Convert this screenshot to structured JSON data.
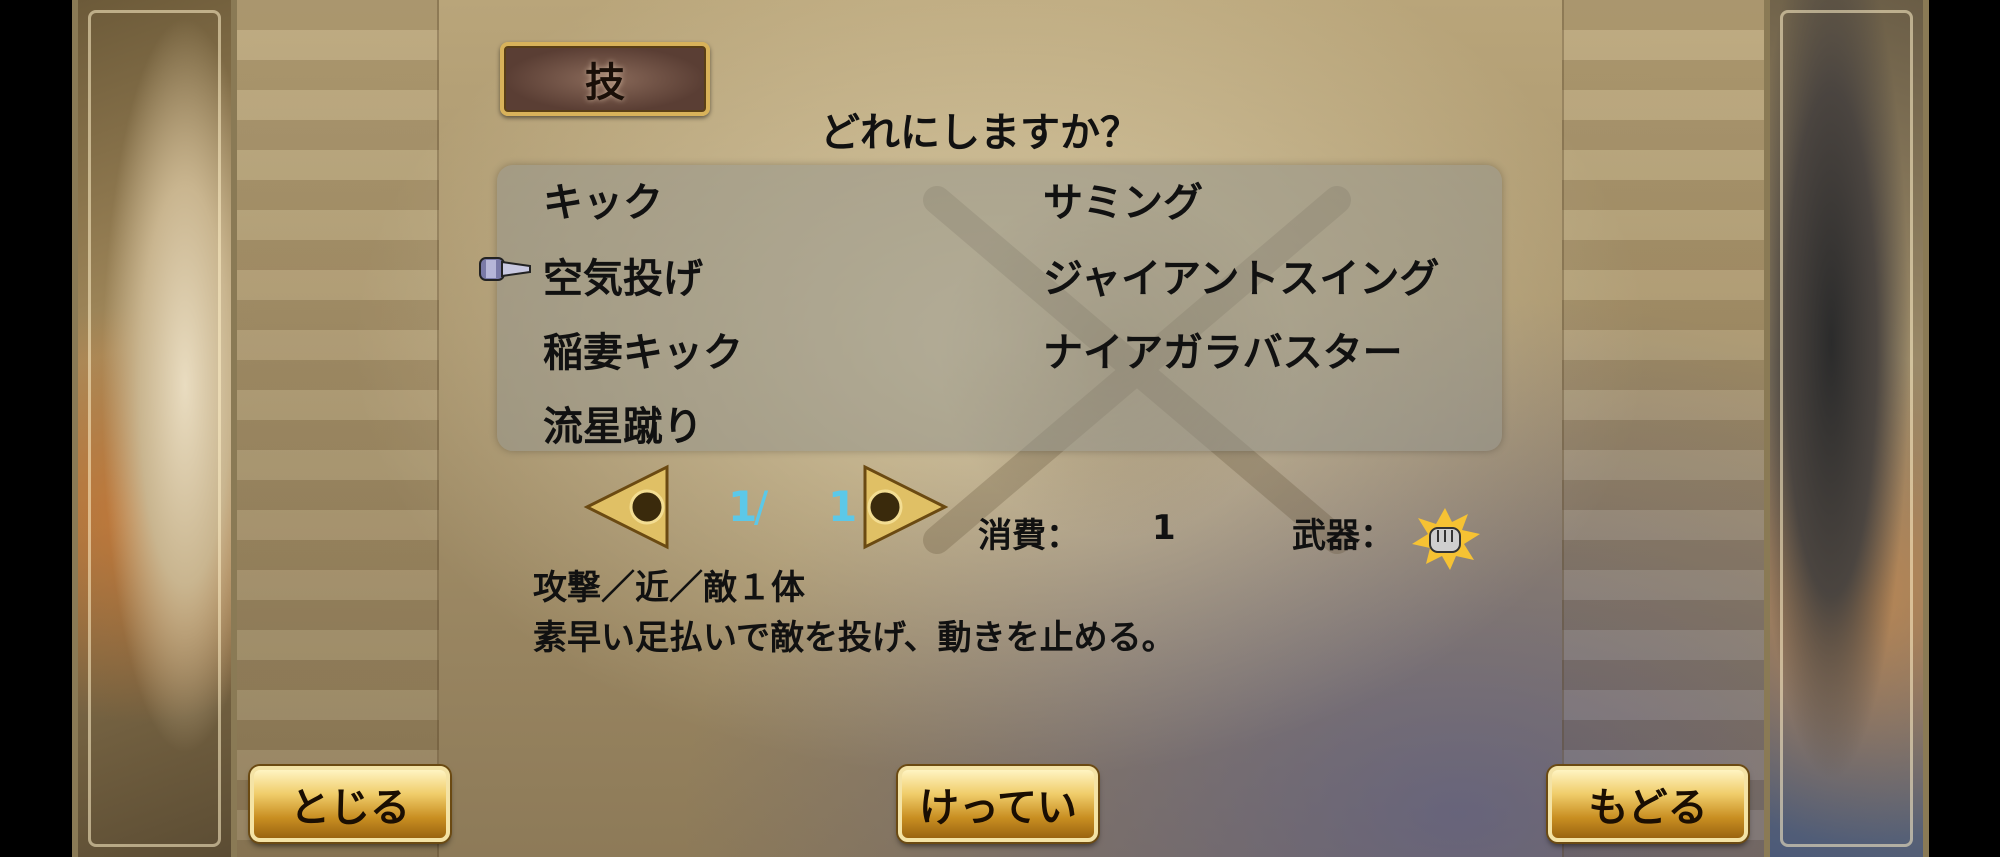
{
  "panel": {
    "title": "技",
    "prompt": "どれにしますか？"
  },
  "skills": {
    "left": [
      "キック",
      "空気投げ",
      "稲妻キック",
      "流星蹴り"
    ],
    "right": [
      "サミング",
      "ジャイアントスイング",
      "ナイアガラバスター"
    ],
    "selected": "空気投げ"
  },
  "pager": {
    "current": "1",
    "separator": "/",
    "total": "1"
  },
  "info": {
    "cost_label": "消費：",
    "cost_value": "1",
    "weapon_label": "武器：",
    "weapon_icon": "fist-icon",
    "description_line1": "攻撃／近／敵１体",
    "description_line2": "素早い足払いで敵を投げ、動きを止める。"
  },
  "buttons": {
    "close": "とじる",
    "confirm": "けってい",
    "back": "もどる"
  },
  "colors": {
    "gold": "#f0cd6b",
    "page_number": "#5cc8e8"
  }
}
